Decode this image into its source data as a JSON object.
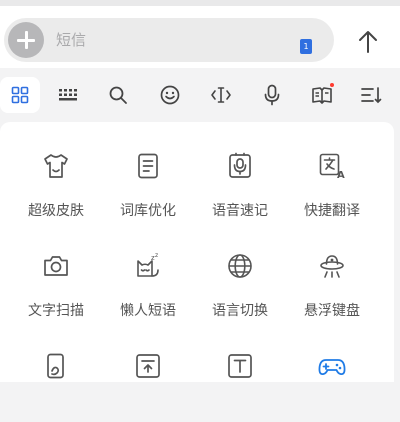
{
  "composer": {
    "sms_placeholder": "短信",
    "sim_badge": "1"
  },
  "toolbar": {
    "items": [
      {
        "icon": "apps-grid-icon",
        "active": true
      },
      {
        "icon": "keyboard-icon"
      },
      {
        "icon": "search-icon"
      },
      {
        "icon": "emoji-icon"
      },
      {
        "icon": "text-cursor-icon"
      },
      {
        "icon": "microphone-icon"
      },
      {
        "icon": "book-icon",
        "dot": true
      },
      {
        "icon": "list-sort-icon"
      }
    ]
  },
  "panel": {
    "items": [
      {
        "label": "超级皮肤",
        "icon": "tshirt-icon"
      },
      {
        "label": "词库优化",
        "icon": "document-icon"
      },
      {
        "label": "语音速记",
        "icon": "voice-note-icon"
      },
      {
        "label": "快捷翻译",
        "icon": "translate-icon"
      },
      {
        "label": "文字扫描",
        "icon": "camera-icon"
      },
      {
        "label": "懒人短语",
        "icon": "lazy-cat-icon"
      },
      {
        "label": "语言切换",
        "icon": "globe-icon"
      },
      {
        "label": "悬浮键盘",
        "icon": "ufo-icon"
      },
      {
        "label": "",
        "icon": "phone-hand-icon"
      },
      {
        "label": "",
        "icon": "keyboard-box-icon"
      },
      {
        "label": "",
        "icon": "text-box-icon"
      },
      {
        "label": "",
        "icon": "gamepad-icon"
      }
    ]
  },
  "colors": {
    "accent_blue": "#2f6fe0",
    "icon_gray": "#555555",
    "gamepad_blue": "#1f7be6"
  }
}
